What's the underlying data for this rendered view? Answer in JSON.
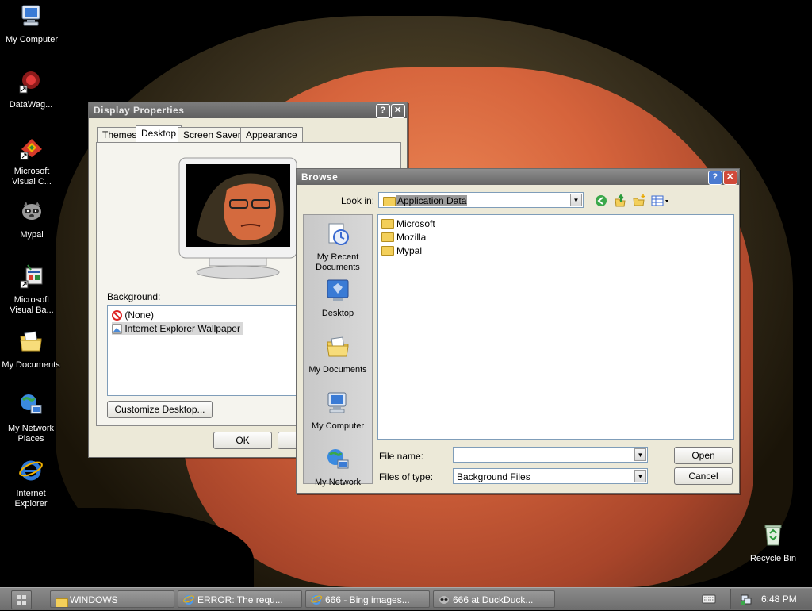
{
  "desktop": {
    "icons": [
      {
        "label": "My Computer"
      },
      {
        "label": "DataWag..."
      },
      {
        "label": "Microsoft Visual C..."
      },
      {
        "label": "Mypal"
      },
      {
        "label": "Microsoft Visual Ba..."
      },
      {
        "label": "My Documents"
      },
      {
        "label": "My Network Places"
      },
      {
        "label": "Internet Explorer"
      },
      {
        "label": "Recycle Bin"
      }
    ]
  },
  "display_properties": {
    "title": "Display Properties",
    "tabs": [
      "Themes",
      "Desktop",
      "Screen Saver",
      "Appearance"
    ],
    "selected_tab": "Desktop",
    "background_label": "Background:",
    "background_items": [
      "(None)",
      "Internet Explorer Wallpaper"
    ],
    "customize_button": "Customize Desktop...",
    "ok_button": "OK"
  },
  "browse": {
    "title": "Browse",
    "look_in_label": "Look in:",
    "look_in_value": "Application Data",
    "places": [
      "My Recent Documents",
      "Desktop",
      "My Documents",
      "My Computer",
      "My Network"
    ],
    "files": [
      "Microsoft",
      "Mozilla",
      "Mypal"
    ],
    "file_name_label": "File name:",
    "file_name_value": "",
    "files_of_type_label": "Files of type:",
    "files_of_type_value": "Background Files",
    "open_button": "Open",
    "cancel_button": "Cancel"
  },
  "taskbar": {
    "buttons": [
      {
        "label": "WINDOWS"
      },
      {
        "label": "ERROR: The requ..."
      },
      {
        "label": "666 - Bing images..."
      },
      {
        "label": "666 at DuckDuck..."
      }
    ],
    "clock": "6:48 PM"
  }
}
